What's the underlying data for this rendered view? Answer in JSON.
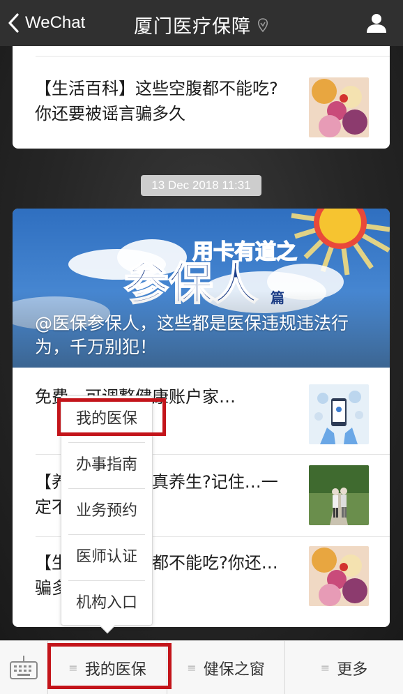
{
  "navbar": {
    "back_label": "WeChat",
    "title": "厦门医疗保障"
  },
  "feed": {
    "card1": {
      "article_title": "【生活百科】这些空腹都不能吃?你还要被谣言骗多久"
    },
    "timestamp": "13 Dec 2018 11:31",
    "card2": {
      "hero_caption": "@医保参保人，这些都是医保违规违法行为，千万别犯！",
      "items": [
        {
          "title": "免费…可调整健康账户家…"
        },
        {
          "title": "【养…饭后散步真养生?记住…一定不要散步，…"
        },
        {
          "title": "【生…这些空腹都不能吃?你还…骗多久"
        }
      ]
    }
  },
  "popup_menu": {
    "items": [
      {
        "label": "我的医保"
      },
      {
        "label": "办事指南"
      },
      {
        "label": "业务预约"
      },
      {
        "label": "医师认证"
      },
      {
        "label": "机构入口"
      }
    ]
  },
  "bottom_bar": {
    "tabs": [
      {
        "label": "我的医保"
      },
      {
        "label": "健保之窗"
      },
      {
        "label": "更多"
      }
    ]
  },
  "colors": {
    "highlight": "#c3141a",
    "nav_bg": "#303030"
  },
  "icons": {
    "back": "chevron-left-icon",
    "title_badge": "verified-icon",
    "profile": "person-icon",
    "keyboard": "keyboard-icon",
    "menu": "menu-lines-icon"
  }
}
